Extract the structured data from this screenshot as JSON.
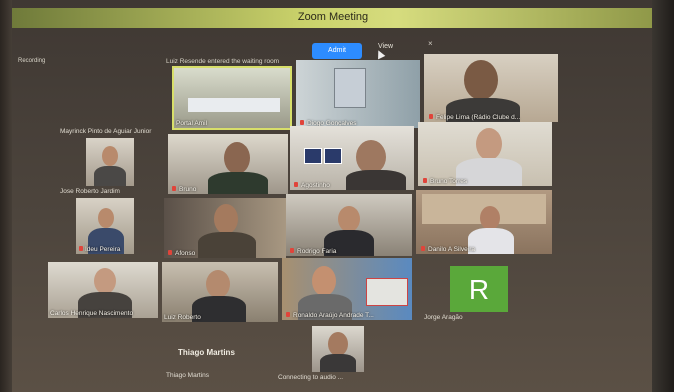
{
  "window": {
    "title": "Zoom Meeting"
  },
  "topbar": {
    "recording_label": "Recording",
    "waiting_message": "Luiz Resende entered the waiting room",
    "admit_label": "Admit",
    "view_label": "View",
    "close_glyph": "×"
  },
  "colors": {
    "active_speaker": "#d8df6a",
    "admit": "#2d8cff",
    "muted_mic": "#e0443a",
    "avatar_r": "#5aa83a"
  },
  "participants": [
    {
      "name": "Portal Amil",
      "muted": false
    },
    {
      "name": "Diogo Gonçalves",
      "muted": true
    },
    {
      "name": "Felipe Lima (Rádio Clube d...",
      "muted": true
    },
    {
      "name": "Mayrinck Pinto de Aguiar Junior",
      "muted": false
    },
    {
      "name": "Jose Roberto Jardim",
      "muted": false
    },
    {
      "name": "Bruno",
      "muted": true
    },
    {
      "name": "Agostinho",
      "muted": true
    },
    {
      "name": "Bruno Torres",
      "muted": true
    },
    {
      "name": "Ideu Pereira",
      "muted": true
    },
    {
      "name": "Afonso",
      "muted": true
    },
    {
      "name": "Rodrigo Faria",
      "muted": true
    },
    {
      "name": "Danilo A Silveira",
      "muted": true
    },
    {
      "name": "Carlos Henrique Nascimento",
      "muted": false
    },
    {
      "name": "Luiz Roberto",
      "muted": false
    },
    {
      "name": "Ronaldo Araújo Andrade T...",
      "muted": true
    },
    {
      "name": "Jorge Aragão",
      "muted": true,
      "avatar_letter": "R"
    },
    {
      "name": "Thiago Martins",
      "muted": true
    },
    {
      "name": "Connecting to audio ...",
      "muted": false
    }
  ],
  "active_speaker_name": "Thiago Martins"
}
